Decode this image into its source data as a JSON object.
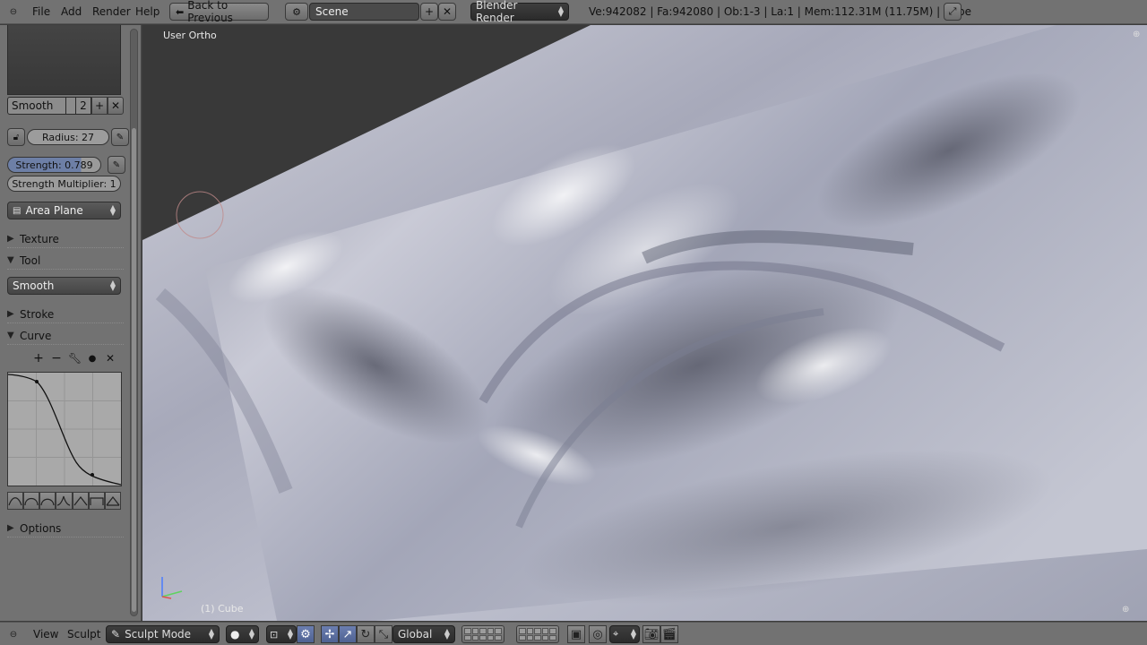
{
  "top_menu": {
    "file": "File",
    "add": "Add",
    "render": "Render",
    "help": "Help",
    "back_to_previous": "Back to Previous",
    "scene": "Scene",
    "render_engine": "Blender Render",
    "stats": "Ve:942082 | Fa:942080 | Ob:1-3 | La:1 | Mem:112.31M (11.75M) | Cube"
  },
  "tool_panel": {
    "brush_name": "Smooth",
    "brush_users": "2",
    "radius": "Radius: 27",
    "strength": "Strength: 0.789",
    "strength_fill": 0.789,
    "strength_multiplier": "Strength Multiplier: 1",
    "sculpt_plane": "Area Plane",
    "sections": {
      "texture": "Texture",
      "tool": "Tool",
      "stroke": "Stroke",
      "curve": "Curve",
      "options": "Options"
    },
    "tool_value": "Smooth"
  },
  "viewport": {
    "view_label": "User Ortho",
    "object_label": "(1) Cube"
  },
  "bottom_bar": {
    "view": "View",
    "sculpt": "Sculpt",
    "mode": "Sculpt Mode",
    "orientation": "Global"
  },
  "colors": {
    "header": "#727272",
    "viewport_bg": "#393939",
    "mesh": "#b4b6c6",
    "accent": "#6d7fa6"
  }
}
